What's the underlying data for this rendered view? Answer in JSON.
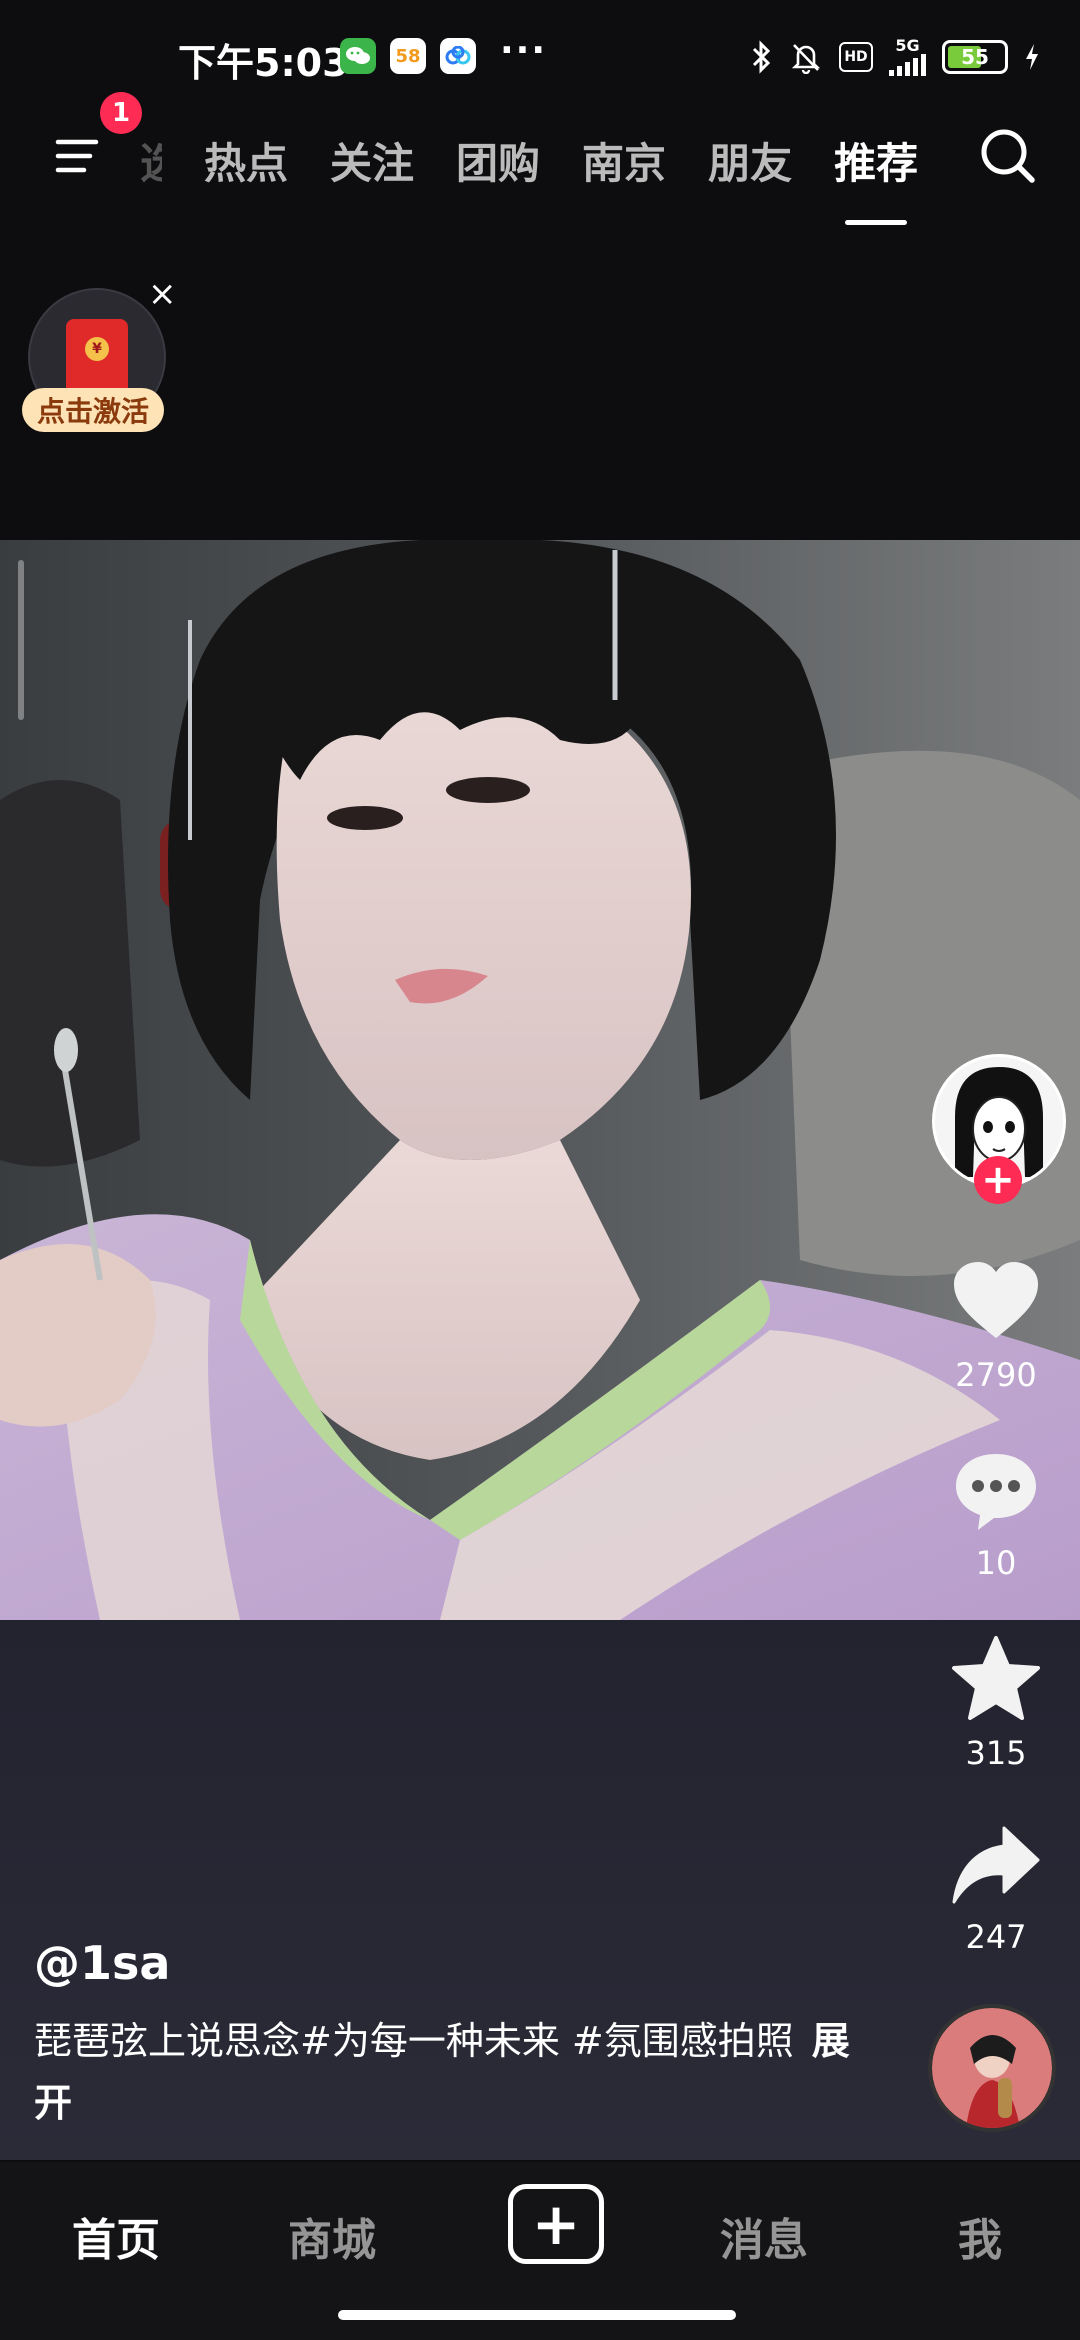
{
  "status_bar": {
    "time": "下午5:03",
    "app_icons": [
      "wechat-icon",
      "58-app-icon",
      "baidu-netdisk-icon"
    ],
    "more": "···",
    "network": "5G",
    "hd": "HD",
    "battery": "55",
    "battery_level": 0.55
  },
  "top_nav": {
    "menu_badge": "1",
    "tabs": [
      {
        "label": "选",
        "partial": true
      },
      {
        "label": "热点"
      },
      {
        "label": "关注"
      },
      {
        "label": "团购"
      },
      {
        "label": "南京"
      },
      {
        "label": "朋友"
      },
      {
        "label": "推荐",
        "active": true
      }
    ]
  },
  "promo": {
    "label": "点击激活",
    "close": "×",
    "icon": "red-packet-icon"
  },
  "post": {
    "author": "@1sa",
    "caption": "琵琶弦上说思念#为每一种未来 #氛围感拍照",
    "expand_label": "展开"
  },
  "actions": {
    "follow": "+",
    "likes": "2790",
    "comments": "10",
    "favorites": "315",
    "shares": "247"
  },
  "bottom_nav": {
    "home": "首页",
    "mall": "商城",
    "create": "+",
    "messages": "消息",
    "me": "我"
  }
}
